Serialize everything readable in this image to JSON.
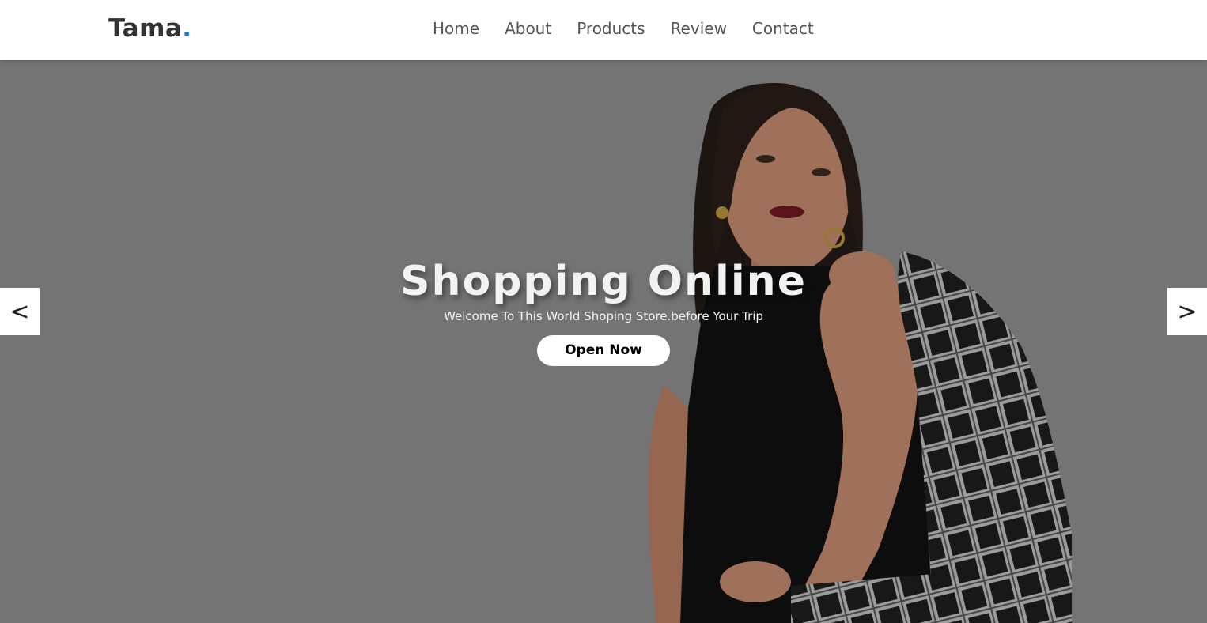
{
  "brand": {
    "name": "Tama",
    "dot": ".",
    "accent": "#2f6fd6"
  },
  "nav": {
    "items": [
      {
        "label": "Home"
      },
      {
        "label": "About"
      },
      {
        "label": "Products"
      },
      {
        "label": "Review"
      },
      {
        "label": "Contact"
      }
    ]
  },
  "hero": {
    "title": "Shopping Online",
    "subtitle": "Welcome To This World Shoping Store.before Your Trip",
    "button_label": "Open Now",
    "prev_label": "<",
    "next_label": ">",
    "background": "#8e8e8e",
    "image": "woman-in-black-sleeveless-top-holding-checked-jacket"
  }
}
